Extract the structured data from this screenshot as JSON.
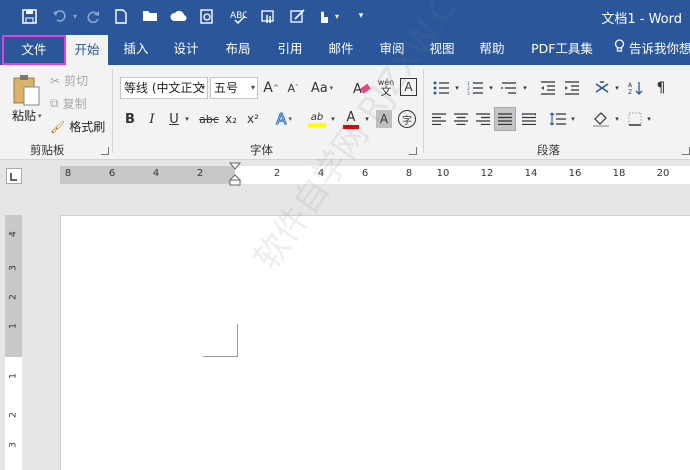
{
  "titlebar": {
    "doc_title": "文档1 - Word",
    "qa_customize": "▾"
  },
  "tabs": {
    "file": "文件",
    "items": [
      "开始",
      "插入",
      "设计",
      "布局",
      "引用",
      "邮件",
      "审阅",
      "视图",
      "帮助",
      "PDF工具集"
    ],
    "tell_me": "告诉我你想"
  },
  "clipboard": {
    "paste": "粘贴",
    "cut": "剪切",
    "copy": "复制",
    "format_painter": "格式刷",
    "label": "剪贴板"
  },
  "font": {
    "font_name": "等线 (中文正文",
    "font_size": "五号",
    "grow": "A",
    "shrink": "A",
    "change_case": "Aa",
    "phonetic": "wén",
    "border_char": "A",
    "bold": "B",
    "italic": "I",
    "underline": "U",
    "strike": "abc",
    "subscript": "x₂",
    "superscript": "x²",
    "text_effects": "A",
    "highlight": "ab",
    "font_color": "A",
    "char_shading": "A",
    "enclosed": "字",
    "label": "字体"
  },
  "paragraph": {
    "label": "段落"
  },
  "colors": {
    "accent": "#2b579a",
    "file_outline": "#e040e0",
    "highlight_yellow": "#ffff00",
    "font_red": "#e00000"
  },
  "ruler": {
    "h_numbers": [
      "8",
      "6",
      "4",
      "2",
      "2",
      "4",
      "6",
      "8",
      "10",
      "12",
      "14",
      "16",
      "18",
      "20"
    ],
    "v_numbers": [
      "4",
      "3",
      "2",
      "1",
      "1",
      "2",
      "3"
    ]
  },
  "watermark": "软件自学网 RJZXW.COM"
}
